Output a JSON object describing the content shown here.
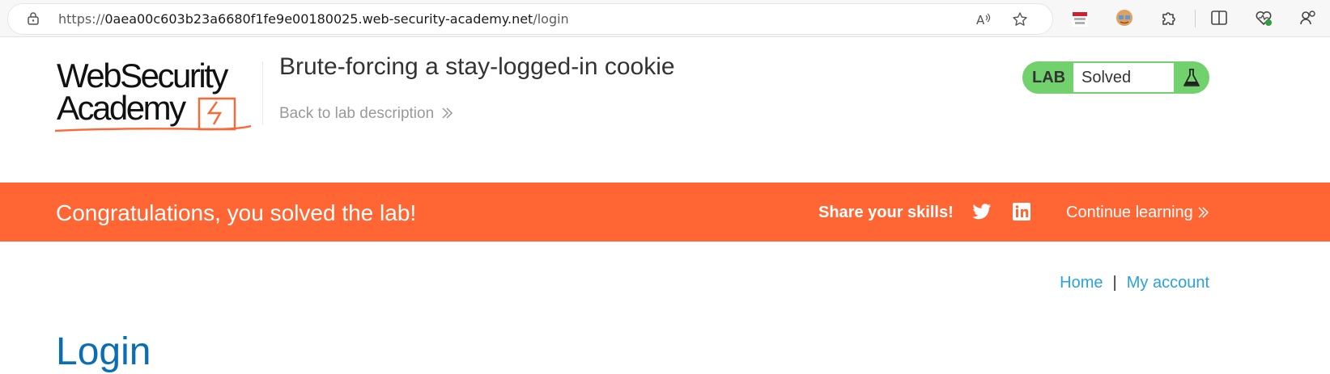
{
  "browser": {
    "url_prefix": "https://",
    "url_host": "0aea00c603b23a6680f1fe9e00180025.web-security-academy.net",
    "url_path": "/login",
    "icons": [
      "lock-icon",
      "read-aloud-icon",
      "favorite-star-icon",
      "extension-flag-icon",
      "profile-extension-icon",
      "extensions-puzzle-icon",
      "split-screen-icon",
      "browser-essentials-icon",
      "profile-icon"
    ]
  },
  "header": {
    "logo_line1": "WebSecurity",
    "logo_line2": "Academy",
    "lab_title": "Brute-forcing a stay-logged-in cookie",
    "back_link": "Back to lab description",
    "lab_badge": "LAB",
    "lab_state": "Solved"
  },
  "banner": {
    "message": "Congratulations, you solved the lab!",
    "share_label": "Share your skills!",
    "continue_label": "Continue learning",
    "colors": {
      "banner": "#ff6633",
      "status_green": "#70d16d",
      "link_blue": "#29a3d9"
    }
  },
  "nav": {
    "home": "Home",
    "separator": "|",
    "my_account": "My account"
  },
  "page": {
    "heading": "Login"
  }
}
